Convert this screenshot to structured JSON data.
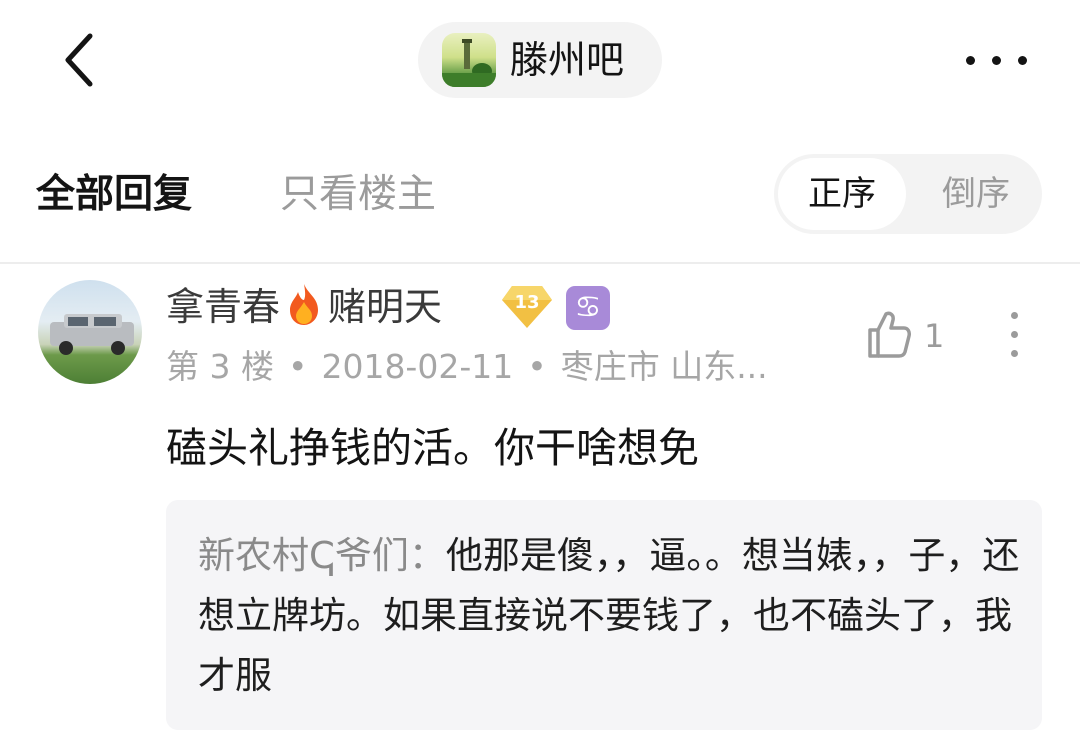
{
  "header": {
    "forum_name": "滕州吧",
    "back_icon": "chevron-left-icon",
    "more_icon": "more-horizontal-icon"
  },
  "tabs": {
    "all_replies": "全部回复",
    "only_op": "只看楼主"
  },
  "order": {
    "ascending": "正序",
    "descending": "倒序",
    "selected": "正序"
  },
  "post": {
    "username_part1": "拿青春",
    "username_part2": "赌明天",
    "level": "13",
    "zodiac_symbol": "♋",
    "floor": "第 3 楼",
    "date": "2018-02-11",
    "location": "枣庄市 山东...",
    "like_count": "1",
    "content": "磕头礼挣钱的活。你干啥想免",
    "quote": {
      "author": "新农村ↅ爷们：",
      "text": "他那是傻，，逼。。想当婊，，子，还想立牌坊。如果直接说不要钱了，也不磕头了，我才服"
    }
  },
  "colors": {
    "primary_text": "#141414",
    "secondary_text": "#9b9b9b",
    "meta_text": "#a6a6a6",
    "pill_bg": "#f3f3f3",
    "quote_bg": "#f5f5f7",
    "level_badge": "#f2c043",
    "zodiac_badge": "#a88ad8"
  }
}
